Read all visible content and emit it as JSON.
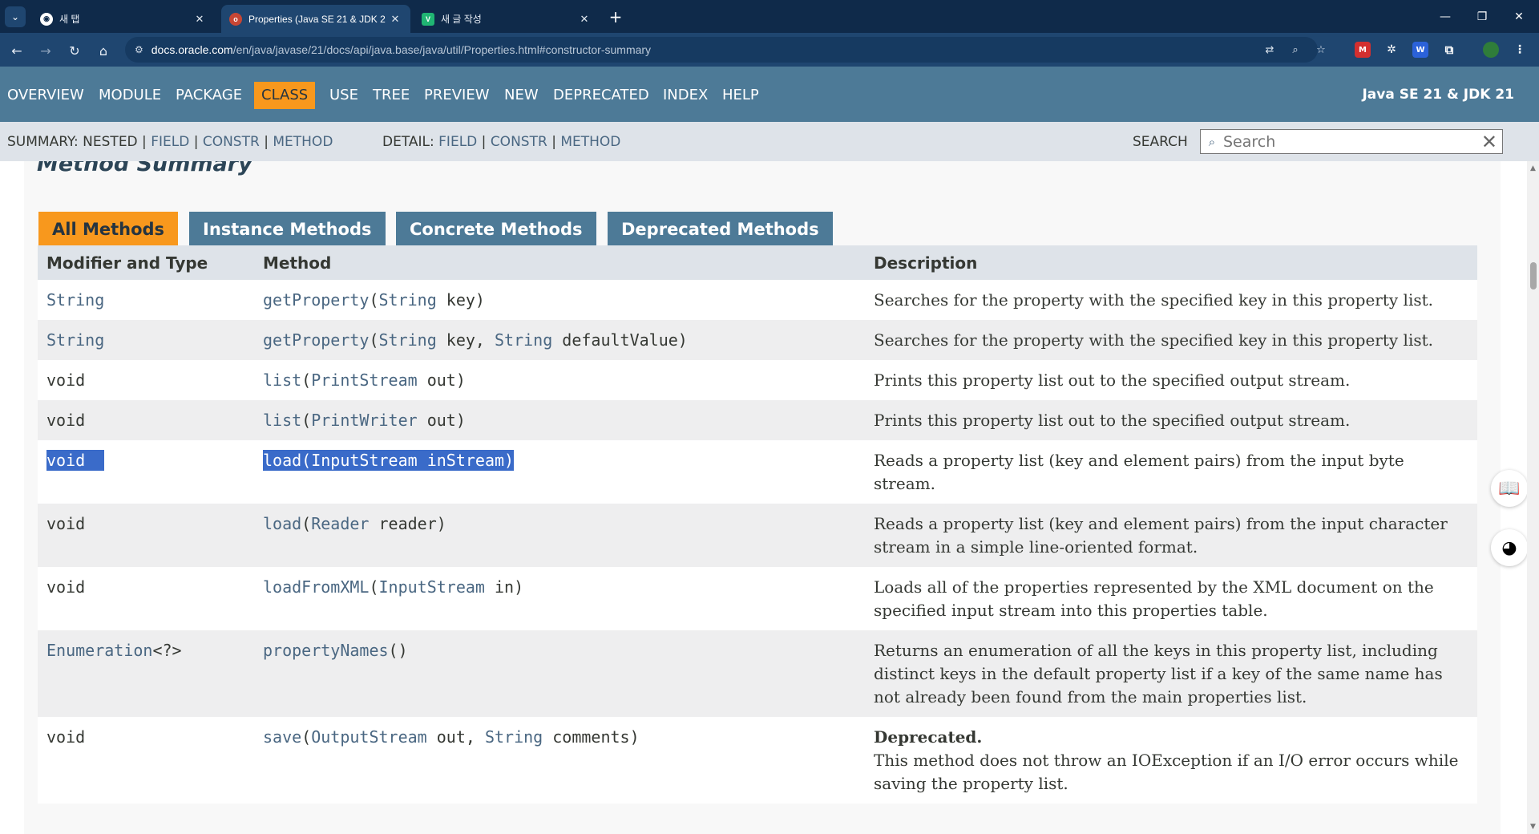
{
  "browser": {
    "tabs": [
      {
        "title": "새 탭",
        "active": false
      },
      {
        "title": "Properties (Java SE 21 & JDK 2",
        "active": true
      },
      {
        "title": "새 글 작성",
        "active": false
      }
    ],
    "url_host": "docs.oracle.com",
    "url_path": "/en/java/javase/21/docs/api/java.base/java/util/Properties.html#constructor-summary"
  },
  "topnav": {
    "items": [
      "OVERVIEW",
      "MODULE",
      "PACKAGE",
      "CLASS",
      "USE",
      "TREE",
      "PREVIEW",
      "NEW",
      "DEPRECATED",
      "INDEX",
      "HELP"
    ],
    "active": "CLASS",
    "brand": "Java SE 21 & JDK 21"
  },
  "subnav": {
    "summary_label": "SUMMARY: NESTED |",
    "summary_links": [
      "FIELD",
      "CONSTR",
      "METHOD"
    ],
    "detail_label": "DETAIL:",
    "detail_links": [
      "FIELD",
      "CONSTR",
      "METHOD"
    ],
    "sep": "|",
    "search_label": "SEARCH",
    "search_placeholder": "Search"
  },
  "section": {
    "title": "Method Summary",
    "tabs": [
      "All Methods",
      "Instance Methods",
      "Concrete Methods",
      "Deprecated Methods"
    ],
    "headers": [
      "Modifier and Type",
      "Method",
      "Description"
    ],
    "rows": [
      {
        "type": "String",
        "type_link": true,
        "name": "getProperty",
        "open": "(",
        "params": [
          [
            "String",
            " key"
          ]
        ],
        "close": ")",
        "desc": "Searches for the property with the specified key in this property list."
      },
      {
        "type": "String",
        "type_link": true,
        "name": "getProperty",
        "open": "(",
        "params": [
          [
            "String",
            " key, "
          ],
          [
            "String",
            " defaultValue"
          ]
        ],
        "close": ")",
        "desc": "Searches for the property with the specified key in this property list."
      },
      {
        "type": "void",
        "type_link": false,
        "name": "list",
        "open": "(",
        "params": [
          [
            "PrintStream",
            " out"
          ]
        ],
        "close": ")",
        "desc": "Prints this property list out to the specified output stream."
      },
      {
        "type": "void",
        "type_link": false,
        "name": "list",
        "open": "(",
        "params": [
          [
            "PrintWriter",
            " out"
          ]
        ],
        "close": ")",
        "desc": "Prints this property list out to the specified output stream."
      },
      {
        "type": "void",
        "type_link": false,
        "name": "load",
        "open": "(",
        "params": [
          [
            "InputStream",
            " inStream"
          ]
        ],
        "close": ")",
        "desc": "Reads a property list (key and element pairs) from the input byte stream.",
        "selected": true
      },
      {
        "type": "void",
        "type_link": false,
        "name": "load",
        "open": "(",
        "params": [
          [
            "Reader",
            " reader"
          ]
        ],
        "close": ")",
        "desc": "Reads a property list (key and element pairs) from the input character stream in a simple line-oriented format."
      },
      {
        "type": "void",
        "type_link": false,
        "name": "loadFromXML",
        "open": "(",
        "params": [
          [
            "InputStream",
            " in"
          ]
        ],
        "close": ")",
        "desc": "Loads all of the properties represented by the XML document on the specified input stream into this properties table."
      },
      {
        "type": "Enumeration",
        "type_suffix": "<?>",
        "type_link": true,
        "name": "propertyNames",
        "open": "(",
        "params": [],
        "close": ")",
        "desc": "Returns an enumeration of all the keys in this property list, including distinct keys in the default property list if a key of the same name has not already been found from the main properties list."
      },
      {
        "type": "void",
        "type_link": false,
        "name": "save",
        "open": "(",
        "params": [
          [
            "OutputStream",
            " out, "
          ],
          [
            "String",
            " comments"
          ]
        ],
        "close": ")",
        "deprecated_label": "Deprecated.",
        "desc": "This method does not throw an IOException if an I/O error occurs while saving the property list."
      }
    ]
  }
}
